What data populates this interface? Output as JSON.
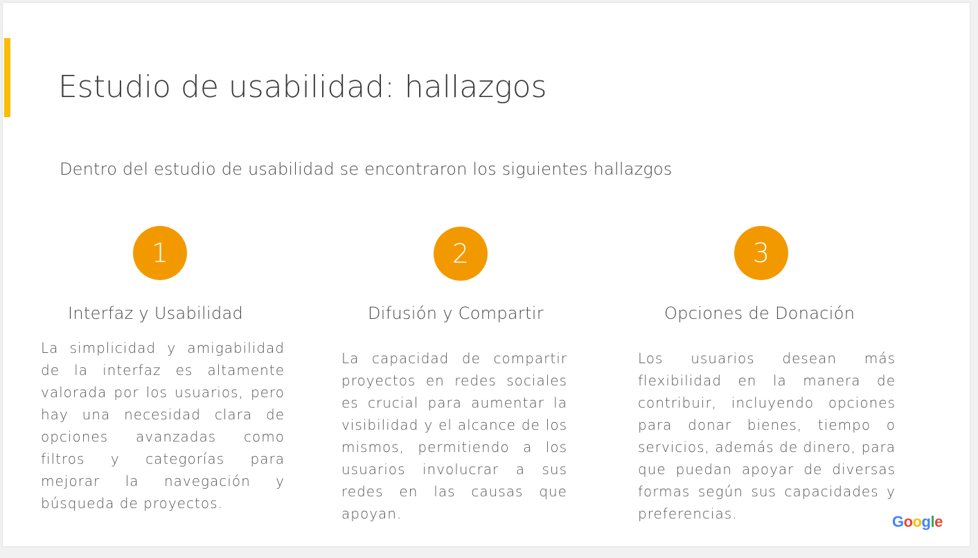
{
  "slide": {
    "title": "Estudio de usabilidad: hallazgos",
    "subtitle": "Dentro del estudio de usabilidad se encontraron los siguientes hallazgos"
  },
  "findings": [
    {
      "number": "1",
      "title": "Interfaz y Usabilidad",
      "body": "La simplicidad y amigabilidad de la interfaz es altamente valorada por los usuarios, pero hay una necesidad clara de opciones avanzadas como filtros y categorías para mejorar la navegación y búsqueda de proyectos."
    },
    {
      "number": "2",
      "title": "Difusión y Compartir",
      "body": "La capacidad de compartir proyectos en redes sociales es crucial para aumentar la visibilidad y el alcance de los mismos, permitiendo a los usuarios involucrar a sus redes en las causas que apoyan."
    },
    {
      "number": "3",
      "title": "Opciones de Donación",
      "body": "Los usuarios desean más flexibilidad en la manera de contribuir, incluyendo opciones para donar bienes, tiempo o servicios, además de dinero, para que puedan apoyar de diversas formas según sus capacidades y preferencias."
    }
  ],
  "logo": {
    "letters": [
      "G",
      "o",
      "o",
      "g",
      "l",
      "e"
    ],
    "colors": [
      "#4285f4",
      "#ea4335",
      "#fbbc05",
      "#4285f4",
      "#34a853",
      "#ea4335"
    ]
  },
  "colors": {
    "accent_bar": "#fbbc05",
    "number_circle": "#f29900",
    "text": "#4a4a4a"
  }
}
